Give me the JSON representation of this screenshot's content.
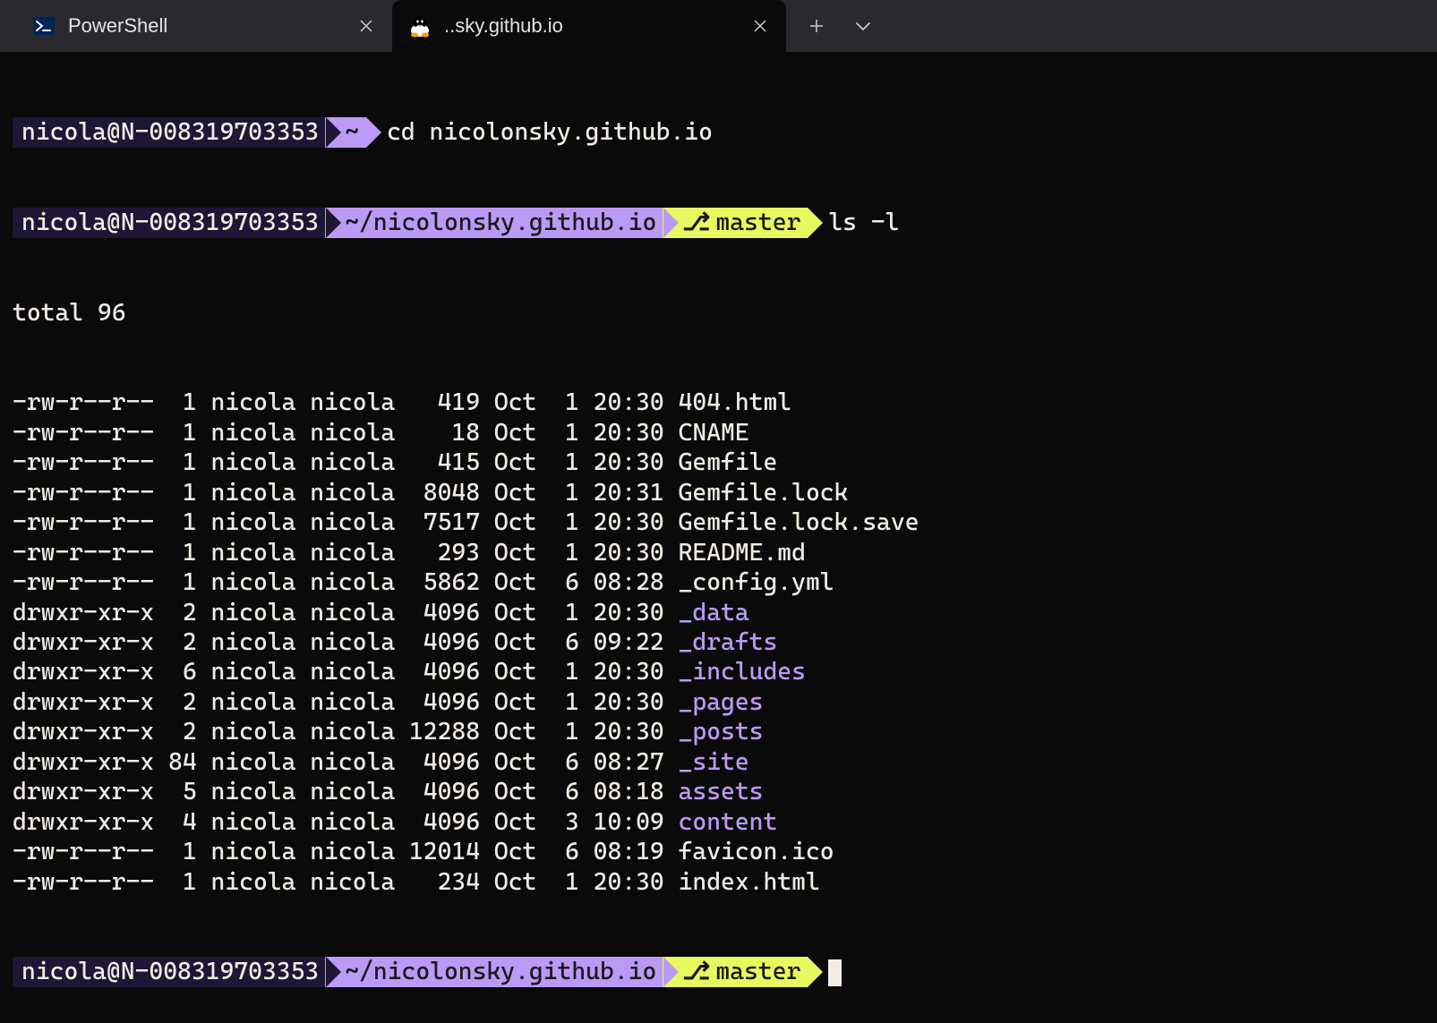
{
  "tabs": [
    {
      "title": "PowerShell",
      "icon": "powershell"
    },
    {
      "title": "..sky.github.io",
      "icon": "tux"
    }
  ],
  "prompts": [
    {
      "user": "nicola@N-008319703353",
      "path": "~",
      "branch": null,
      "cmd": "cd nicolonsky.github.io"
    },
    {
      "user": "nicola@N-008319703353",
      "path": "~/nicolonsky.github.io",
      "branch": "master",
      "cmd": "ls -l"
    }
  ],
  "ls_total": "total 96",
  "files": [
    {
      "perm": "-rw-r--r--",
      "links": "1",
      "owner": "nicola",
      "group": "nicola",
      "size": "419",
      "month": "Oct",
      "day": "1",
      "time": "20:30",
      "name": "404.html",
      "dir": false
    },
    {
      "perm": "-rw-r--r--",
      "links": "1",
      "owner": "nicola",
      "group": "nicola",
      "size": "18",
      "month": "Oct",
      "day": "1",
      "time": "20:30",
      "name": "CNAME",
      "dir": false
    },
    {
      "perm": "-rw-r--r--",
      "links": "1",
      "owner": "nicola",
      "group": "nicola",
      "size": "415",
      "month": "Oct",
      "day": "1",
      "time": "20:30",
      "name": "Gemfile",
      "dir": false
    },
    {
      "perm": "-rw-r--r--",
      "links": "1",
      "owner": "nicola",
      "group": "nicola",
      "size": "8048",
      "month": "Oct",
      "day": "1",
      "time": "20:31",
      "name": "Gemfile.lock",
      "dir": false
    },
    {
      "perm": "-rw-r--r--",
      "links": "1",
      "owner": "nicola",
      "group": "nicola",
      "size": "7517",
      "month": "Oct",
      "day": "1",
      "time": "20:30",
      "name": "Gemfile.lock.save",
      "dir": false
    },
    {
      "perm": "-rw-r--r--",
      "links": "1",
      "owner": "nicola",
      "group": "nicola",
      "size": "293",
      "month": "Oct",
      "day": "1",
      "time": "20:30",
      "name": "README.md",
      "dir": false
    },
    {
      "perm": "-rw-r--r--",
      "links": "1",
      "owner": "nicola",
      "group": "nicola",
      "size": "5862",
      "month": "Oct",
      "day": "6",
      "time": "08:28",
      "name": "_config.yml",
      "dir": false
    },
    {
      "perm": "drwxr-xr-x",
      "links": "2",
      "owner": "nicola",
      "group": "nicola",
      "size": "4096",
      "month": "Oct",
      "day": "1",
      "time": "20:30",
      "name": "_data",
      "dir": true
    },
    {
      "perm": "drwxr-xr-x",
      "links": "2",
      "owner": "nicola",
      "group": "nicola",
      "size": "4096",
      "month": "Oct",
      "day": "6",
      "time": "09:22",
      "name": "_drafts",
      "dir": true
    },
    {
      "perm": "drwxr-xr-x",
      "links": "6",
      "owner": "nicola",
      "group": "nicola",
      "size": "4096",
      "month": "Oct",
      "day": "1",
      "time": "20:30",
      "name": "_includes",
      "dir": true
    },
    {
      "perm": "drwxr-xr-x",
      "links": "2",
      "owner": "nicola",
      "group": "nicola",
      "size": "4096",
      "month": "Oct",
      "day": "1",
      "time": "20:30",
      "name": "_pages",
      "dir": true
    },
    {
      "perm": "drwxr-xr-x",
      "links": "2",
      "owner": "nicola",
      "group": "nicola",
      "size": "12288",
      "month": "Oct",
      "day": "1",
      "time": "20:30",
      "name": "_posts",
      "dir": true
    },
    {
      "perm": "drwxr-xr-x",
      "links": "84",
      "owner": "nicola",
      "group": "nicola",
      "size": "4096",
      "month": "Oct",
      "day": "6",
      "time": "08:27",
      "name": "_site",
      "dir": true
    },
    {
      "perm": "drwxr-xr-x",
      "links": "5",
      "owner": "nicola",
      "group": "nicola",
      "size": "4096",
      "month": "Oct",
      "day": "6",
      "time": "08:18",
      "name": "assets",
      "dir": true
    },
    {
      "perm": "drwxr-xr-x",
      "links": "4",
      "owner": "nicola",
      "group": "nicola",
      "size": "4096",
      "month": "Oct",
      "day": "3",
      "time": "10:09",
      "name": "content",
      "dir": true
    },
    {
      "perm": "-rw-r--r--",
      "links": "1",
      "owner": "nicola",
      "group": "nicola",
      "size": "12014",
      "month": "Oct",
      "day": "6",
      "time": "08:19",
      "name": "favicon.ico",
      "dir": false
    },
    {
      "perm": "-rw-r--r--",
      "links": "1",
      "owner": "nicola",
      "group": "nicola",
      "size": "234",
      "month": "Oct",
      "day": "1",
      "time": "20:30",
      "name": "index.html",
      "dir": false
    }
  ],
  "final_prompt": {
    "user": "nicola@N-008319703353",
    "path": "~/nicolonsky.github.io",
    "branch": "master"
  }
}
